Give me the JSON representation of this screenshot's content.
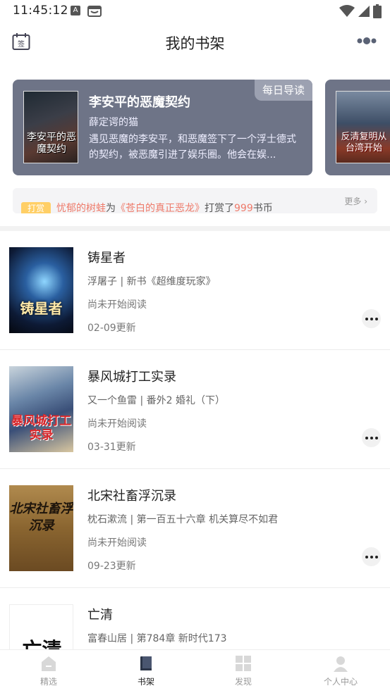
{
  "status": {
    "time": "11:45:12",
    "notif_a": "A"
  },
  "header": {
    "title": "我的书架"
  },
  "featured": {
    "badge": "每日导读",
    "title": "李安平的恶魔契约",
    "author": "薛定谔的猫",
    "desc": "遇见恶魔的李安平，和恶魔签下了一个浮士德式的契约，被恶魔引进了娱乐圈。他会在娱...",
    "cover_text": "李安平的恶魔契约",
    "next_cover_text": "反清复明从台湾开始"
  },
  "tip": {
    "badge": "打赏",
    "user": "忧郁的树蛙",
    "mid1": "为",
    "book": "《苍白的真正恶龙》",
    "mid2": "打赏了",
    "amount": "999",
    "unit": "书币",
    "more": "更多"
  },
  "books": [
    {
      "title": "铸星者",
      "meta": "浮屠子 | 新书《超维度玩家》",
      "progress": "尚未开始阅读",
      "update": "02-09更新",
      "cover_text": "铸星者"
    },
    {
      "title": "暴风城打工实录",
      "meta": "又一个鱼雷 | 番外2 婚礼（下）",
      "progress": "尚未开始阅读",
      "update": "03-31更新",
      "cover_text": "暴风城打工实录"
    },
    {
      "title": "北宋社畜浮沉录",
      "meta": "枕石漱流 | 第一百五十六章 机关算尽不如君",
      "progress": "尚未开始阅读",
      "update": "09-23更新",
      "cover_text": "北宋社畜浮沉录"
    },
    {
      "title": "亡清",
      "meta": "富春山居 | 第784章 新时代173",
      "progress": "",
      "update": "",
      "cover_text": "亡清"
    }
  ],
  "nav": [
    {
      "label": "精选",
      "icon": "home-icon"
    },
    {
      "label": "书架",
      "icon": "bookshelf-icon",
      "active": true
    },
    {
      "label": "发现",
      "icon": "discover-grid-icon"
    },
    {
      "label": "个人中心",
      "icon": "person-icon"
    }
  ]
}
